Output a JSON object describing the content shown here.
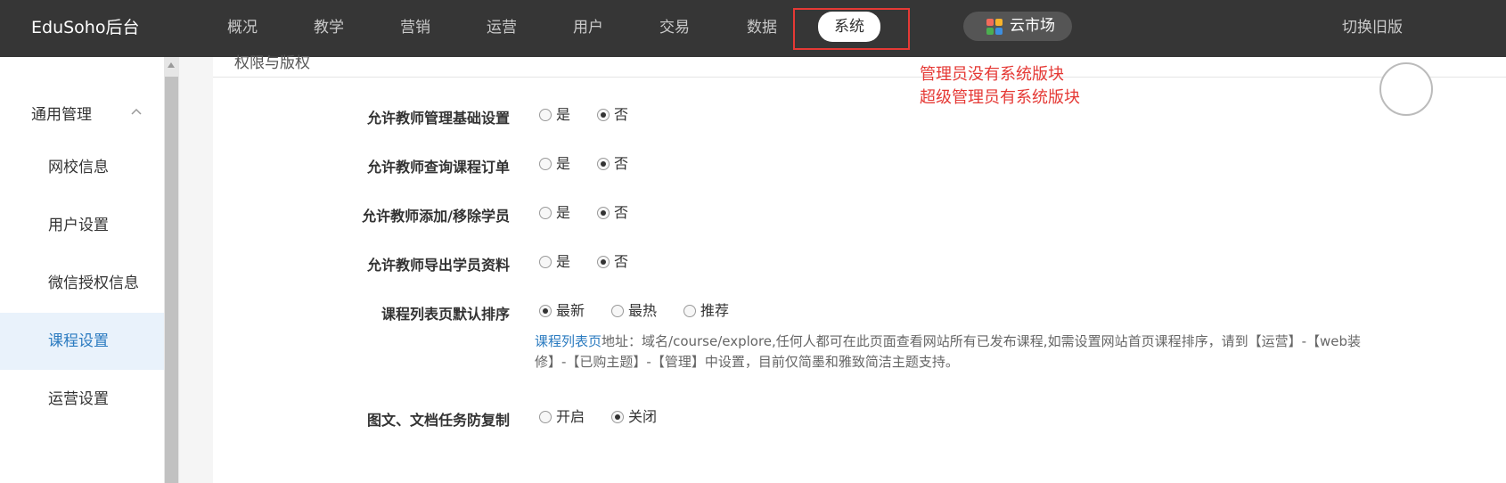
{
  "topbar": {
    "brand": "EduSoho后台",
    "nav": [
      "概况",
      "教学",
      "营销",
      "运营",
      "用户",
      "交易",
      "数据",
      "系统"
    ],
    "active_nav": "系统",
    "market_label": "云市场",
    "switch_old": "切换旧版"
  },
  "sidebar": {
    "group_label": "通用管理",
    "items": [
      "网校信息",
      "用户设置",
      "微信授权信息",
      "课程设置",
      "运营设置"
    ],
    "active_item": "课程设置"
  },
  "main": {
    "section_title": "权限与版权",
    "annotation": [
      "管理员没有系统版块",
      "超级管理员有系统版块"
    ],
    "rows": [
      {
        "label": "允许教师管理基础设置",
        "options": [
          "是",
          "否"
        ],
        "selected": "否"
      },
      {
        "label": "允许教师查询课程订单",
        "options": [
          "是",
          "否"
        ],
        "selected": "否"
      },
      {
        "label": "允许教师添加/移除学员",
        "options": [
          "是",
          "否"
        ],
        "selected": "否"
      },
      {
        "label": "允许教师导出学员资料",
        "options": [
          "是",
          "否"
        ],
        "selected": "否"
      },
      {
        "label": "课程列表页默认排序",
        "options": [
          "最新",
          "最热",
          "推荐"
        ],
        "selected": "最新"
      },
      {
        "label": "图文、文档任务防复制",
        "options": [
          "开启",
          "关闭"
        ],
        "selected": "关闭"
      }
    ],
    "help": {
      "link": "课程列表页",
      "text": "地址：域名/course/explore,任何人都可在此页面查看网站所有已发布课程,如需设置网站首页课程排序，请到【运营】-【web装修】-【已购主题】-【管理】中设置，目前仅简墨和雅致简洁主题支持。"
    }
  },
  "colors": {
    "topbar_bg": "#363636",
    "accent": "#2b7bc0",
    "annotation": "#e53935",
    "active_side_bg": "#e9f2fb"
  }
}
